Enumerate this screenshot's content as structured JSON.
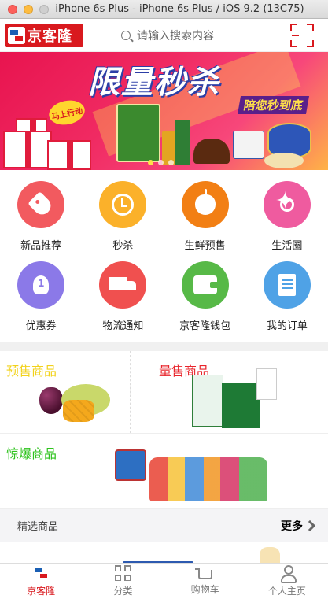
{
  "window": {
    "title": "iPhone 6s Plus - iPhone 6s Plus / iOS 9.2 (13C75)"
  },
  "header": {
    "logo_text": "京客隆",
    "search_placeholder": "请输入搜索内容",
    "scan_icon": "qr-scan-icon"
  },
  "banner": {
    "title": "限量秒杀",
    "subtitle": "陪您秒到底",
    "badge": "马上行动",
    "page_count": 3,
    "active_index": 0
  },
  "categories": [
    {
      "label": "新品推荐",
      "icon": "tag-icon",
      "color": "#f25a5f"
    },
    {
      "label": "秒杀",
      "icon": "clock-icon",
      "color": "#fbb12a"
    },
    {
      "label": "生鲜预售",
      "icon": "apple-icon",
      "color": "#f27f14"
    },
    {
      "label": "生活圈",
      "icon": "compass-icon",
      "color": "#ef5b9f"
    },
    {
      "label": "优惠券",
      "icon": "medal-icon",
      "color": "#8b79e8"
    },
    {
      "label": "物流通知",
      "icon": "truck-icon",
      "color": "#f0504f"
    },
    {
      "label": "京客隆钱包",
      "icon": "wallet-icon",
      "color": "#57b947"
    },
    {
      "label": "我的订单",
      "icon": "document-icon",
      "color": "#4fa2e6"
    }
  ],
  "goods": {
    "presale": {
      "title": "预售商品",
      "color": "#f2d21b"
    },
    "volume": {
      "title": "量售商品",
      "color": "#e8242b"
    },
    "hot": {
      "title": "惊爆商品",
      "color": "#2ec31d"
    }
  },
  "featured": {
    "title": "精选商品",
    "more_label": "更多"
  },
  "tabbar": [
    {
      "label": "京客隆",
      "icon": "home-logo-icon",
      "active": true
    },
    {
      "label": "分类",
      "icon": "grid-icon",
      "active": false
    },
    {
      "label": "购物车",
      "icon": "cart-icon",
      "active": false
    },
    {
      "label": "个人主页",
      "icon": "user-icon",
      "active": false
    }
  ]
}
